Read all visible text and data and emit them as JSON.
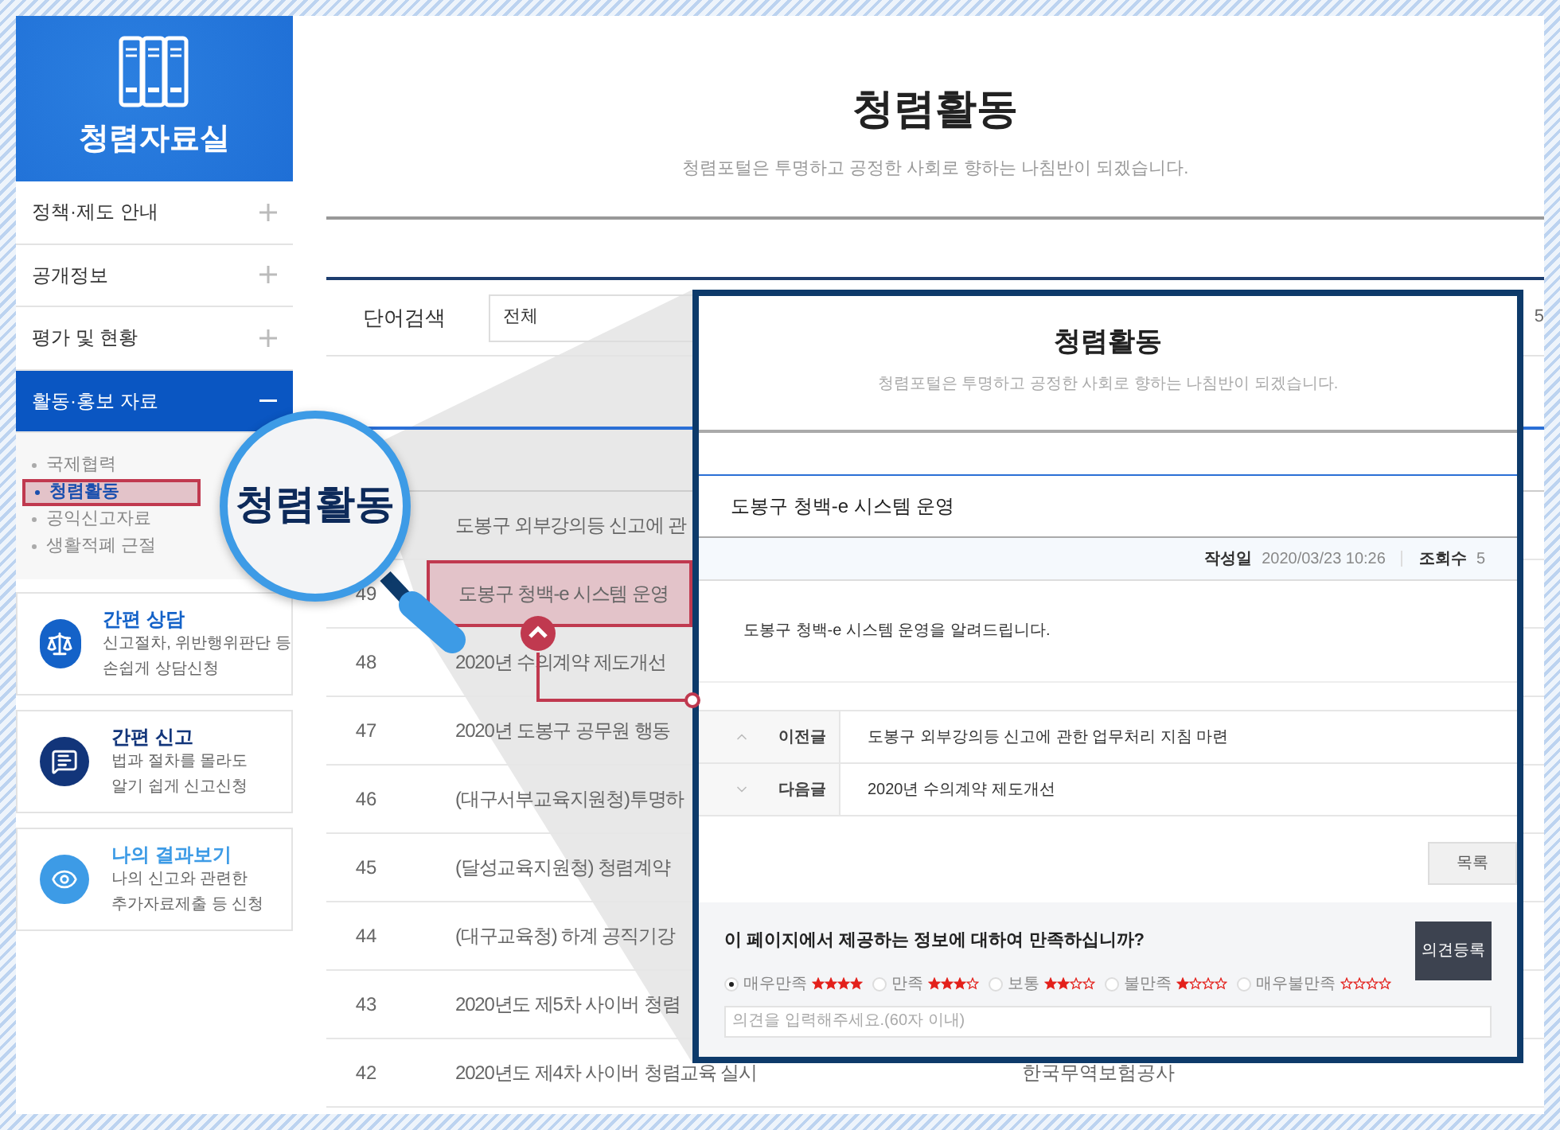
{
  "sidebar": {
    "title": "청렴자료실",
    "menu": [
      {
        "label": "정책·제도 안내",
        "expanded": false
      },
      {
        "label": "공개정보",
        "expanded": false
      },
      {
        "label": "평가 및 현황",
        "expanded": false
      },
      {
        "label": "활동·홍보 자료",
        "expanded": true,
        "children": [
          {
            "label": "국제협력",
            "selected": false
          },
          {
            "label": "청렴활동",
            "selected": true
          },
          {
            "label": "공익신고자료",
            "selected": false
          },
          {
            "label": "생활적폐 근절",
            "selected": false
          }
        ]
      }
    ],
    "shortcuts": [
      {
        "kind": "consult",
        "title": "간편 상담",
        "lines": [
          "신고절차, 위반행위판단 등",
          "손쉽게 상담신청"
        ]
      },
      {
        "kind": "report",
        "title": "간편 신고",
        "lines": [
          "법과 절차를 몰라도",
          "알기 쉽게 신고신청"
        ]
      },
      {
        "kind": "result",
        "title": "나의 결과보기",
        "lines": [
          "나의 신고와 관련한",
          "추가자료제출 등 신청"
        ]
      }
    ]
  },
  "page": {
    "title": "청렴활동",
    "subtitle": "청렴포털은 투명하고 공정한 사회로 향하는 나침반이 되겠습니다.",
    "search": {
      "label": "단어검색",
      "value": "전체",
      "trailing": "5"
    },
    "rows": [
      {
        "title": "도봉구 외부강의등 신고에 관",
        "highlighted": false
      },
      {
        "number": "49",
        "title": "도봉구 청백-e 시스템 운영",
        "highlighted": true
      },
      {
        "number": "48",
        "title": "2020년 수의계약 제도개선",
        "highlighted": false
      },
      {
        "number": "47",
        "title": "2020년 도봉구 공무원 행동",
        "highlighted": false
      },
      {
        "number": "46",
        "title": "(대구서부교육지원청)투명하",
        "highlighted": false
      },
      {
        "number": "45",
        "title": "(달성교육지원청) 청렴계약",
        "highlighted": false
      },
      {
        "number": "44",
        "title": "(대구교육청) 하계 공직기강",
        "highlighted": false
      },
      {
        "number": "43",
        "title": "2020년도 제5차 사이버 청렴",
        "highlighted": false
      },
      {
        "number": "42",
        "title": "2020년도 제4차 사이버 청렴교육 실시",
        "department": "한국무역보험공사",
        "highlighted": false
      }
    ]
  },
  "magnifier": {
    "text": "청렴활동"
  },
  "popup": {
    "title": "청렴활동",
    "subtitle": "청렴포털은 투명하고 공정한 사회로 향하는 나침반이 되겠습니다.",
    "post_title": "도봉구 청백-e 시스템 운영",
    "meta": [
      {
        "label": "작성일",
        "value": "2020/03/23 10:26"
      },
      {
        "label": "조회수",
        "value": "5"
      }
    ],
    "body": "도봉구 청백-e 시스템 운영을 알려드립니다.",
    "neighbors": [
      {
        "kind": "prev",
        "label": "이전글",
        "title": "도봉구 외부강의등 신고에 관한 업무처리 지침 마련"
      },
      {
        "kind": "next",
        "label": "다음글",
        "title": "2020년 수의계약 제도개선"
      }
    ],
    "list_button": "목록",
    "survey": {
      "question": "이 페이지에서 제공하는 정보에 대하여 만족하십니까?",
      "options": [
        {
          "label": "매우만족",
          "stars": 4,
          "selected": true
        },
        {
          "label": "만족",
          "stars": 3,
          "selected": false
        },
        {
          "label": "보통",
          "stars": 2,
          "selected": false
        },
        {
          "label": "불만족",
          "stars": 1,
          "selected": false
        },
        {
          "label": "매우불만족",
          "stars": 0,
          "selected": false
        }
      ],
      "submit": "의견등록",
      "placeholder": "의견을 입력해주세요.(60자 이내)"
    }
  }
}
